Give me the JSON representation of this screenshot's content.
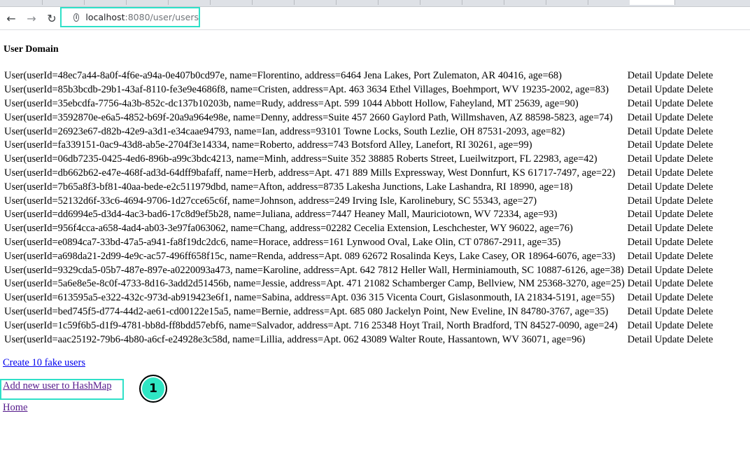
{
  "browser": {
    "url_host": "localhost",
    "url_path": ":8080/user/users"
  },
  "page": {
    "title": "User Domain"
  },
  "users": [
    "User(userId=48ec7a44-8a0f-4f6e-a94a-0e407b0cd97e, name=Florentino, address=6464 Jena Lakes, Port Zulematon, AR 40416, age=68)",
    "User(userId=85b3bcdb-29b1-43af-8110-fe3e9e4686f8, name=Cristen, address=Apt. 463 3634 Ethel Villages, Boehmport, WV 19235-2002, age=83)",
    "User(userId=35ebcdfa-7756-4a3b-852c-dc137b10203b, name=Rudy, address=Apt. 599 1044 Abbott Hollow, Faheyland, MT 25639, age=90)",
    "User(userId=3592870e-e6a5-4852-b69f-20a9a964e98e, name=Denny, address=Suite 457 2660 Gaylord Path, Willmshaven, AZ 88598-5823, age=74)",
    "User(userId=26923e67-d82b-42e9-a3d1-e34caae94793, name=Ian, address=93101 Towne Locks, South Lezlie, OH 87531-2093, age=82)",
    "User(userId=fa339151-0ac9-43d8-ab5e-2704f3e14334, name=Roberto, address=743 Botsford Alley, Lanefort, RI 30261, age=99)",
    "User(userId=06db7235-0425-4ed6-896b-a99c3bdc4213, name=Minh, address=Suite 352 38885 Roberts Street, Lueilwitzport, FL 22983, age=42)",
    "User(userId=db662b62-e47e-468f-ad3d-64dff9bafaff, name=Herb, address=Apt. 471 889 Mills Expressway, West Donnfurt, KS 61717-7497, age=22)",
    "User(userId=7b65a8f3-bf81-40aa-bede-e2c511979dbd, name=Afton, address=8735 Lakesha Junctions, Lake Lashandra, RI 18990, age=18)",
    "User(userId=52132d6f-33c6-4694-9706-1d27cce65c6f, name=Johnson, address=249 Irving Isle, Karolinebury, SC 55343, age=27)",
    "User(userId=dd6994e5-d3d4-4ac3-bad6-17c8d9ef5b28, name=Juliana, address=7447 Heaney Mall, Mauriciotown, WV 72334, age=93)",
    "User(userId=956f4cca-a658-4ad4-ab03-3e97fa063062, name=Chang, address=02282 Cecelia Extension, Leschchester, WY 96022, age=76)",
    "User(userId=e0894ca7-33bd-47a5-a941-fa8f19dc2dc6, name=Horace, address=161 Lynwood Oval, Lake Olin, CT 07867-2911, age=35)",
    "User(userId=a698da21-2d99-4e9c-ac57-496ff658f15c, name=Renda, address=Apt. 089 62672 Rosalinda Keys, Lake Casey, OR 18964-6076, age=33)",
    "User(userId=9329cda5-05b7-487e-897e-a0220093a473, name=Karoline, address=Apt. 642 7812 Heller Wall, Herminiamouth, SC 10887-6126, age=38)",
    "User(userId=5a6e8e5e-8c0f-4733-8d16-3add2d51456b, name=Jessie, address=Apt. 471 21082 Schamberger Camp, Bellview, NM 25368-3270, age=25)",
    "User(userId=613595a5-e322-432c-973d-ab919423e6f1, name=Sabina, address=Apt. 036 315 Vicenta Court, Gislasonmouth, IA 21834-5191, age=55)",
    "User(userId=bed745f5-d774-44d2-ae61-cd00122e15a5, name=Bernie, address=Apt. 685 080 Jackelyn Point, New Eveline, IN 84780-3767, age=35)",
    "User(userId=1c59f6b5-d1f9-4781-bb8d-ff8bdd57ebf6, name=Salvador, address=Apt. 716 25348 Hoyt Trail, North Bradford, TN 84527-0090, age=24)",
    "User(userId=aac25192-79b6-4b80-a6cf-e24928e3c58d, name=Lillia, address=Apt. 062 43089 Walter Route, Hassantown, WV 36071, age=96)"
  ],
  "actions": {
    "detail": "Detail",
    "update": "Update",
    "delete": "Delete"
  },
  "links": {
    "create_fake": "Create 10 fake users",
    "add_new": "Add new user to HashMap",
    "home": "Home"
  },
  "annotation": {
    "step": "1",
    "highlight_color": "#2fe0c8"
  }
}
